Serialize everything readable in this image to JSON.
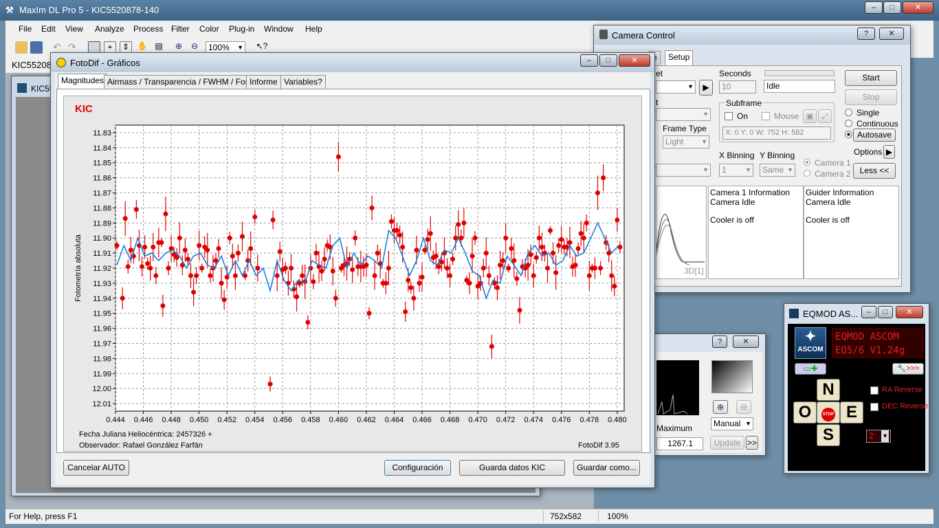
{
  "app": {
    "title": "MaxIm DL Pro 5 - KIC5520878-140"
  },
  "menu": [
    "File",
    "Edit",
    "View",
    "Analyze",
    "Process",
    "Filter",
    "Color",
    "Plug-in",
    "Window",
    "Help"
  ],
  "toolbar": {
    "zoom": "100%"
  },
  "doc": {
    "tab_label": "KIC55208",
    "inner_label": "KIC55"
  },
  "fotodif": {
    "title": "FotoDif - Gráficos",
    "tabs": [
      "Magnitudes",
      "Airmass / Transparencia / FWHM / Fondo",
      "Informe",
      "Variables?"
    ],
    "footer_left1": "Fecha Juliana Heliocéntrica: 2457326 +",
    "footer_left2": "Observador: Rafael González Farfán",
    "footer_right": "FotoDif 3.95",
    "buttons": {
      "cancel": "Cancelar AUTO",
      "config": "Configuración",
      "save_kic": "Guarda datos KIC",
      "save_as": "Guardar como..."
    }
  },
  "chart_data": {
    "type": "scatter",
    "title": "KIC",
    "xlabel": "",
    "ylabel": "Fotometría absoluta",
    "xlim": [
      0.444,
      0.4805
    ],
    "ylim": [
      11.825,
      12.015
    ],
    "y_inverted": true,
    "grid": true,
    "x_ticks": [
      "0.444",
      "0.446",
      "0.448",
      "0.450",
      "0.452",
      "0.454",
      "0.456",
      "0.458",
      "0.460",
      "0.462",
      "0.464",
      "0.466",
      "0.468",
      "0.470",
      "0.472",
      "0.474",
      "0.476",
      "0.478",
      "0.480"
    ],
    "y_ticks": [
      "11.83",
      "11.84",
      "11.85",
      "11.86",
      "11.87",
      "11.88",
      "11.89",
      "11.90",
      "11.91",
      "11.92",
      "11.93",
      "11.94",
      "11.95",
      "11.96",
      "11.97",
      "11.98",
      "11.99",
      "12.00",
      "12.01"
    ],
    "series": [
      {
        "kind": "points_with_errorbars",
        "color": "#e00000",
        "points": [
          [
            0.4441,
            11.905
          ],
          [
            0.4445,
            11.94
          ],
          [
            0.4447,
            11.887
          ],
          [
            0.4449,
            11.919
          ],
          [
            0.4451,
            11.908
          ],
          [
            0.4453,
            11.912
          ],
          [
            0.4455,
            11.881
          ],
          [
            0.4457,
            11.905
          ],
          [
            0.4459,
            11.919
          ],
          [
            0.4461,
            11.906
          ],
          [
            0.4463,
            11.917
          ],
          [
            0.4465,
            11.92
          ],
          [
            0.4467,
            11.906
          ],
          [
            0.4469,
            11.925
          ],
          [
            0.4471,
            11.903
          ],
          [
            0.4473,
            11.903
          ],
          [
            0.4474,
            11.945
          ],
          [
            0.4476,
            11.884
          ],
          [
            0.4478,
            11.92
          ],
          [
            0.448,
            11.907
          ],
          [
            0.4482,
            11.911
          ],
          [
            0.4484,
            11.913
          ],
          [
            0.4486,
            11.9
          ],
          [
            0.4488,
            11.918
          ],
          [
            0.449,
            11.908
          ],
          [
            0.4492,
            11.914
          ],
          [
            0.4494,
            11.925
          ],
          [
            0.4496,
            11.936
          ],
          [
            0.4498,
            11.925
          ],
          [
            0.45,
            11.905
          ],
          [
            0.4502,
            11.92
          ],
          [
            0.4504,
            11.906
          ],
          [
            0.4506,
            11.908
          ],
          [
            0.4508,
            11.925
          ],
          [
            0.451,
            11.92
          ],
          [
            0.4512,
            11.915
          ],
          [
            0.4514,
            11.907
          ],
          [
            0.4516,
            11.93
          ],
          [
            0.4518,
            11.941
          ],
          [
            0.452,
            11.926
          ],
          [
            0.4522,
            11.9
          ],
          [
            0.4524,
            11.912
          ],
          [
            0.4526,
            11.925
          ],
          [
            0.4528,
            11.91
          ],
          [
            0.4531,
            11.899
          ],
          [
            0.4533,
            11.925
          ],
          [
            0.4535,
            11.915
          ],
          [
            0.4537,
            11.907
          ],
          [
            0.454,
            11.886
          ],
          [
            0.4542,
            11.92
          ],
          [
            0.4551,
            11.997
          ],
          [
            0.4553,
            11.888
          ],
          [
            0.4556,
            11.925
          ],
          [
            0.4558,
            11.909
          ],
          [
            0.456,
            11.921
          ],
          [
            0.4562,
            11.92
          ],
          [
            0.4564,
            11.93
          ],
          [
            0.4566,
            11.92
          ],
          [
            0.4568,
            11.934
          ],
          [
            0.457,
            11.939
          ],
          [
            0.4572,
            11.93
          ],
          [
            0.4574,
            11.925
          ],
          [
            0.4576,
            11.929
          ],
          [
            0.4578,
            11.956
          ],
          [
            0.458,
            11.92
          ],
          [
            0.4582,
            11.929
          ],
          [
            0.4584,
            11.91
          ],
          [
            0.4586,
            11.919
          ],
          [
            0.4588,
            11.922
          ],
          [
            0.459,
            11.914
          ],
          [
            0.4592,
            11.905
          ],
          [
            0.4594,
            11.906
          ],
          [
            0.4596,
            11.922
          ],
          [
            0.4598,
            11.94
          ],
          [
            0.46,
            11.846
          ],
          [
            0.4602,
            11.92
          ],
          [
            0.4604,
            11.918
          ],
          [
            0.4606,
            11.917
          ],
          [
            0.4608,
            11.914
          ],
          [
            0.461,
            11.921
          ],
          [
            0.4612,
            11.9
          ],
          [
            0.4614,
            11.919
          ],
          [
            0.4616,
            11.919
          ],
          [
            0.4618,
            11.919
          ],
          [
            0.462,
            11.918
          ],
          [
            0.4622,
            11.95
          ],
          [
            0.4624,
            11.88
          ],
          [
            0.4626,
            11.925
          ],
          [
            0.4628,
            11.91
          ],
          [
            0.463,
            11.917
          ],
          [
            0.4632,
            11.93
          ],
          [
            0.4634,
            11.93
          ],
          [
            0.4636,
            11.92
          ],
          [
            0.4638,
            11.889
          ],
          [
            0.464,
            11.895
          ],
          [
            0.4642,
            11.895
          ],
          [
            0.4644,
            11.898
          ],
          [
            0.4646,
            11.906
          ],
          [
            0.4648,
            11.949
          ],
          [
            0.465,
            11.928
          ],
          [
            0.4652,
            11.933
          ],
          [
            0.4654,
            11.94
          ],
          [
            0.4656,
            11.908
          ],
          [
            0.4658,
            11.93
          ],
          [
            0.466,
            11.926
          ],
          [
            0.4662,
            11.908
          ],
          [
            0.4664,
            11.901
          ],
          [
            0.4666,
            11.897
          ],
          [
            0.4668,
            11.913
          ],
          [
            0.467,
            11.912
          ],
          [
            0.4672,
            11.919
          ],
          [
            0.4674,
            11.916
          ],
          [
            0.4676,
            11.91
          ],
          [
            0.4678,
            11.92
          ],
          [
            0.468,
            11.925
          ],
          [
            0.4682,
            11.914
          ],
          [
            0.4684,
            11.9
          ],
          [
            0.4686,
            11.891
          ],
          [
            0.4688,
            11.9
          ],
          [
            0.469,
            11.89
          ],
          [
            0.4692,
            11.928
          ],
          [
            0.4694,
            11.93
          ],
          [
            0.4696,
            11.912
          ],
          [
            0.4698,
            11.9
          ],
          [
            0.47,
            11.932
          ],
          [
            0.4702,
            11.93
          ],
          [
            0.4704,
            11.92
          ],
          [
            0.4706,
            11.91
          ],
          [
            0.4708,
            11.925
          ],
          [
            0.471,
            11.972
          ],
          [
            0.4712,
            11.93
          ],
          [
            0.4714,
            11.933
          ],
          [
            0.4716,
            11.918
          ],
          [
            0.4718,
            11.915
          ],
          [
            0.472,
            11.9
          ],
          [
            0.4722,
            11.92
          ],
          [
            0.4724,
            11.907
          ],
          [
            0.4726,
            11.915
          ],
          [
            0.4728,
            11.927
          ],
          [
            0.473,
            11.948
          ],
          [
            0.4732,
            11.919
          ],
          [
            0.4734,
            11.92
          ],
          [
            0.4736,
            11.918
          ],
          [
            0.4738,
            11.911
          ],
          [
            0.474,
            11.925
          ],
          [
            0.4742,
            11.913
          ],
          [
            0.4744,
            11.9
          ],
          [
            0.4746,
            11.906
          ],
          [
            0.4748,
            11.91
          ],
          [
            0.475,
            11.92
          ],
          [
            0.4752,
            11.895
          ],
          [
            0.4754,
            11.91
          ],
          [
            0.4756,
            11.923
          ],
          [
            0.4758,
            11.905
          ],
          [
            0.476,
            11.901
          ],
          [
            0.4762,
            11.906
          ],
          [
            0.4764,
            11.906
          ],
          [
            0.4766,
            11.903
          ],
          [
            0.4768,
            11.919
          ],
          [
            0.477,
            11.918
          ],
          [
            0.4772,
            11.907
          ],
          [
            0.4774,
            11.897
          ],
          [
            0.4776,
            11.9
          ],
          [
            0.4778,
            11.89
          ],
          [
            0.478,
            11.925
          ],
          [
            0.4782,
            11.92
          ],
          [
            0.4784,
            11.92
          ],
          [
            0.4786,
            11.87
          ],
          [
            0.4788,
            11.92
          ],
          [
            0.479,
            11.86
          ],
          [
            0.4792,
            11.903
          ],
          [
            0.4794,
            11.91
          ],
          [
            0.4796,
            11.925
          ],
          [
            0.4798,
            11.932
          ],
          [
            0.48,
            11.888
          ],
          [
            0.4802,
            11.906
          ]
        ]
      },
      {
        "kind": "line",
        "color": "#1a7fdc",
        "values": [
          [
            0.4441,
            11.918
          ],
          [
            0.4446,
            11.905
          ],
          [
            0.4451,
            11.915
          ],
          [
            0.4456,
            11.9
          ],
          [
            0.4461,
            11.912
          ],
          [
            0.4466,
            11.91
          ],
          [
            0.4471,
            11.915
          ],
          [
            0.4476,
            11.91
          ],
          [
            0.4481,
            11.908
          ],
          [
            0.4486,
            11.912
          ],
          [
            0.4491,
            11.92
          ],
          [
            0.4496,
            11.912
          ],
          [
            0.4501,
            11.91
          ],
          [
            0.4506,
            11.918
          ],
          [
            0.4511,
            11.92
          ],
          [
            0.4516,
            11.912
          ],
          [
            0.4521,
            11.925
          ],
          [
            0.4526,
            11.915
          ],
          [
            0.4531,
            11.925
          ],
          [
            0.4536,
            11.915
          ],
          [
            0.4541,
            11.925
          ],
          [
            0.4546,
            11.92
          ],
          [
            0.4551,
            11.935
          ],
          [
            0.4556,
            11.915
          ],
          [
            0.4561,
            11.928
          ],
          [
            0.4566,
            11.935
          ],
          [
            0.4571,
            11.928
          ],
          [
            0.4576,
            11.93
          ],
          [
            0.4581,
            11.915
          ],
          [
            0.4586,
            11.918
          ],
          [
            0.4591,
            11.92
          ],
          [
            0.4596,
            11.905
          ],
          [
            0.4601,
            11.9
          ],
          [
            0.4606,
            11.92
          ],
          [
            0.4611,
            11.91
          ],
          [
            0.4616,
            11.918
          ],
          [
            0.4621,
            11.912
          ],
          [
            0.4626,
            11.915
          ],
          [
            0.4631,
            11.92
          ],
          [
            0.4636,
            11.895
          ],
          [
            0.4641,
            11.9
          ],
          [
            0.4646,
            11.912
          ],
          [
            0.4651,
            11.925
          ],
          [
            0.4656,
            11.915
          ],
          [
            0.4661,
            11.9
          ],
          [
            0.4666,
            11.915
          ],
          [
            0.4671,
            11.918
          ],
          [
            0.4676,
            11.908
          ],
          [
            0.4681,
            11.91
          ],
          [
            0.4686,
            11.9
          ],
          [
            0.4691,
            11.91
          ],
          [
            0.4696,
            11.922
          ],
          [
            0.4701,
            11.925
          ],
          [
            0.4706,
            11.94
          ],
          [
            0.4711,
            11.928
          ],
          [
            0.4716,
            11.93
          ],
          [
            0.4721,
            11.912
          ],
          [
            0.4726,
            11.918
          ],
          [
            0.4731,
            11.925
          ],
          [
            0.4736,
            11.91
          ],
          [
            0.4741,
            11.905
          ],
          [
            0.4746,
            11.912
          ],
          [
            0.4751,
            11.91
          ],
          [
            0.4756,
            11.918
          ],
          [
            0.4761,
            11.915
          ],
          [
            0.4766,
            11.905
          ],
          [
            0.4771,
            11.912
          ],
          [
            0.4776,
            11.91
          ],
          [
            0.4781,
            11.9
          ],
          [
            0.4786,
            11.89
          ],
          [
            0.4791,
            11.9
          ],
          [
            0.4796,
            11.91
          ],
          [
            0.4801,
            11.905
          ]
        ]
      }
    ]
  },
  "camera": {
    "title": "Camera Control",
    "tab_e": "e",
    "tab_setup": "Setup",
    "et_label": "et",
    "t_label": "t",
    "seconds_label": "Seconds",
    "seconds_value": "10",
    "status": "Idle",
    "start": "Start",
    "stop": "Stop",
    "subframe": "Subframe",
    "on": "On",
    "mouse": "Mouse",
    "subframe_info": "X:   0 Y:   0 W: 752 H: 582",
    "single": "Single",
    "continuous": "Continuous",
    "autosave": "Autosave",
    "frame_type_label": "Frame Type",
    "frame_type": "Light",
    "options": "Options",
    "less": "Less <<",
    "xbin_label": "X Binning",
    "xbin": "1",
    "ybin_label": "Y Binning",
    "ybin": "Same",
    "camera1": "Camera 1",
    "camera2": "Camera 2",
    "info1_title": "Camera 1 Information",
    "info1_status": "Camera Idle",
    "info1_cooler": "Cooler is off",
    "info2_title": "Guider Information",
    "info2_status": "Camera Idle",
    "info2_cooler": "Cooler is off",
    "plot_label": "3D[1]"
  },
  "screen": {
    "maximum_label": "Maximum",
    "maximum_value": "1267.1",
    "mode": "Manual",
    "update": "Update",
    "more": ">>"
  },
  "eqmod": {
    "title": "EQMOD AS...",
    "ascom": "ASCOM",
    "line1": "EQMOD  ASCOM",
    "line2": "EQ5/6  V1.24g",
    "tool": ">>>",
    "north": "N",
    "south": "S",
    "east": "E",
    "west": "O",
    "stop": "STOP",
    "ra_reverse": "RA Reverse",
    "dec_reverse": "DEC Reverse",
    "rate": "2"
  },
  "status": {
    "help": "For Help, press F1",
    "size": "752x582",
    "zoom": "100%"
  }
}
